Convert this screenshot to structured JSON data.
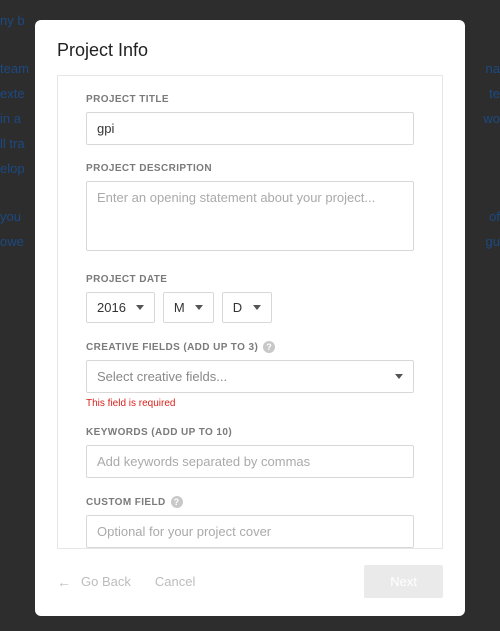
{
  "bg": {
    "l1": " ny b",
    "l2": "team",
    "l3": "exte",
    "l4": " in a",
    "l5": "ll tra",
    "l6": "elop",
    "l7": " you ",
    "l8": "owe",
    "r2": "na",
    "r3": "te",
    "r4": "wo",
    "r7": "of",
    "r8": "gu"
  },
  "modal": {
    "title": "Project Info"
  },
  "fields": {
    "title_label": "PROJECT TITLE",
    "title_value": "gpi",
    "desc_label": "PROJECT DESCRIPTION",
    "desc_placeholder": "Enter an opening statement about your project...",
    "date_label": "PROJECT DATE",
    "date_year": "2016",
    "date_month": "M",
    "date_day": "D",
    "creative_label": "CREATIVE FIELDS (ADD UP TO 3)",
    "creative_placeholder": "Select creative fields...",
    "creative_error": "This field is required",
    "keywords_label": "KEYWORDS (ADD UP TO 10)",
    "keywords_placeholder": "Add keywords separated by commas",
    "custom_label": "CUSTOM FIELD",
    "custom_placeholder": "Optional for your project cover"
  },
  "footer": {
    "go_back": "Go Back",
    "cancel": "Cancel",
    "next": "Next"
  }
}
